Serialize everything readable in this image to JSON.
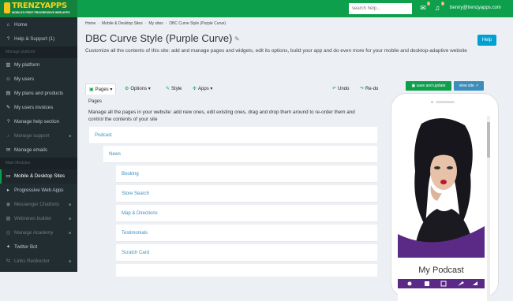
{
  "header": {
    "logo_text": "TRENZYAPPS",
    "logo_tagline": "WORLD'S FIRST PROGRESSIVE WEB APPS",
    "search_placeholder": "search help...",
    "user_email": "benny@trenzyapps.com",
    "icons": [
      "inbox-icon",
      "bell-icon"
    ]
  },
  "sidebar": {
    "items": [
      {
        "icon": "⌂",
        "label": "Home"
      },
      {
        "icon": "?",
        "label": "Help & Support (1)"
      }
    ],
    "section1": "Manage platform",
    "items2": [
      {
        "icon": "▥",
        "label": "My platform"
      },
      {
        "icon": "☺",
        "label": "My users"
      },
      {
        "icon": "▤",
        "label": "My plans and products"
      },
      {
        "icon": "✎",
        "label": "My users invoices"
      },
      {
        "icon": "?",
        "label": "Manage help section"
      },
      {
        "icon": "♪",
        "label": "Manage support"
      },
      {
        "icon": "✉",
        "label": "Manage emails"
      }
    ],
    "section2": "Main Modules",
    "items3": [
      {
        "icon": "▭",
        "label": "Mobile & Desktop Sites"
      },
      {
        "icon": "▸",
        "label": "Progressive Web Apps"
      },
      {
        "icon": "◉",
        "label": "Messenger Chatbots"
      },
      {
        "icon": "▦",
        "label": "Webnews builder"
      },
      {
        "icon": "◎",
        "label": "Manage Academy"
      },
      {
        "icon": "✦",
        "label": "Twitter Bot"
      },
      {
        "icon": "⇆",
        "label": "Links Redirector"
      }
    ]
  },
  "breadcrumb": [
    "Home",
    "Mobile & Desktop Sites",
    "My sites",
    "DBC Curve Style (Purple Curve)"
  ],
  "page": {
    "title": "DBC Curve Style (Purple Curve)",
    "help_label": "Help",
    "description": "Customize all the contents of this site: add and manage pages and widgets, edit its options, build your app and do even more for your mobile and desktop-adaptive website"
  },
  "toolbar": {
    "pages": "Pages",
    "options": "Options",
    "style": "Style",
    "apps": "Apps",
    "undo": "Undo",
    "redo": "Re-do",
    "save": "save and update",
    "view": "view site"
  },
  "pages_panel": {
    "label": "Pages",
    "description": "Manage all the pages in your website: add new ones, edit existing ones, drag and drop them around to re-order them and control the contents of your site",
    "tree": [
      {
        "label": "Podcast",
        "level": 0
      },
      {
        "label": "News",
        "level": 1
      },
      {
        "label": "Booking",
        "level": 2
      },
      {
        "label": "Store Search",
        "level": 2
      },
      {
        "label": "Map & Directions",
        "level": 2
      },
      {
        "label": "Testimonials",
        "level": 2
      },
      {
        "label": "Scratch Card",
        "level": 2
      },
      {
        "label": "",
        "level": 2
      }
    ]
  },
  "preview": {
    "podcast_title": "My Podcast",
    "accent_color": "#5b2a86"
  }
}
